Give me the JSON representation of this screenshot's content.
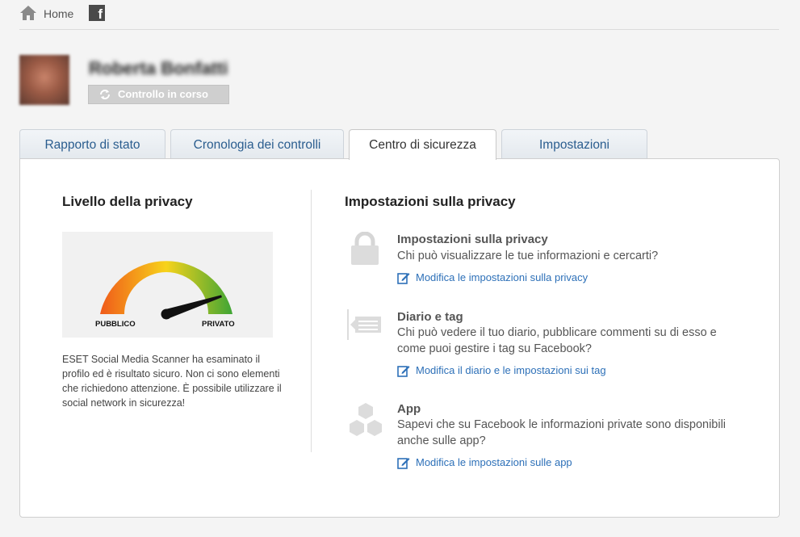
{
  "nav": {
    "home_label": "Home",
    "facebook_glyph": "f"
  },
  "profile": {
    "name": "Roberta Bonfatti",
    "status_label": "Controllo in corso"
  },
  "tabs": [
    {
      "label": "Rapporto di stato"
    },
    {
      "label": "Cronologia dei controlli"
    },
    {
      "label": "Centro di sicurezza",
      "active": true
    },
    {
      "label": "Impostazioni"
    }
  ],
  "privacy_level": {
    "title": "Livello della privacy",
    "gauge": {
      "left_label": "PUBBLICO",
      "right_label": "PRIVATO",
      "level": 0.9
    },
    "description": "ESET Social Media Scanner ha esaminato il profilo ed è risultato sicuro. Non ci sono elementi che richiedono attenzione. È possibile utilizzare il social network in sicurezza!"
  },
  "privacy_settings": {
    "title": "Impostazioni sulla privacy",
    "sections": [
      {
        "icon": "lock-icon",
        "title": "Impostazioni sulla privacy",
        "description": "Chi può visualizzare le tue informazioni e cercarti?",
        "link": "Modifica le impostazioni sulla privacy"
      },
      {
        "icon": "timeline-icon",
        "title": "Diario e tag",
        "description": "Chi può vedere il tuo diario, pubblicare commenti su di esso e come puoi gestire i tag su Facebook?",
        "link": "Modifica il diario e le impostazioni sui tag"
      },
      {
        "icon": "hexagons-icon",
        "title": "App",
        "description": "Sapevi che su Facebook le informazioni private sono disponibili anche sulle app?",
        "link": "Modifica le impostazioni sulle app"
      }
    ]
  },
  "colors": {
    "link": "#2d70b8",
    "tab_text": "#2a5d8f",
    "gauge_low": "#f05a1a",
    "gauge_mid": "#f7d31b",
    "gauge_high": "#3fa535"
  }
}
